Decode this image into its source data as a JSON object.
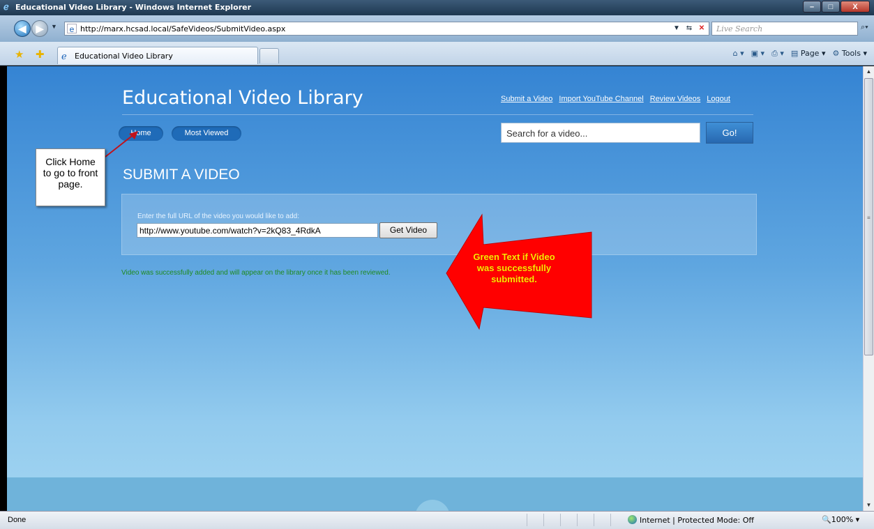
{
  "window": {
    "title": "Educational Video Library - Windows Internet Explorer",
    "min": "–",
    "max": "□",
    "close": "X"
  },
  "browser": {
    "url": "http://marx.hcsad.local/SafeVideos/SubmitVideo.aspx",
    "live_search_placeholder": "Live Search",
    "tab_label": "Educational Video Library",
    "commands": {
      "page": "Page",
      "tools": "Tools"
    }
  },
  "site": {
    "title": "Educational Video Library",
    "top_links": [
      "Submit a Video",
      "Import YouTube Channel",
      "Review Videos",
      "Logout"
    ],
    "nav": {
      "home": "Home",
      "most_viewed": "Most Viewed"
    },
    "search_placeholder": "Search for a video...",
    "go_label": "Go!"
  },
  "main": {
    "section_title": "SUBMIT A VIDEO",
    "form_label": "Enter the full URL of the video you would like to add:",
    "url_value": "http://www.youtube.com/watch?v=2kQ83_4RdkA",
    "get_button": "Get Video",
    "success_message": "Video was successfully added and will appear on the library once it has been reviewed."
  },
  "annotations": {
    "callout": "Click Home to go to front page.",
    "callout_lines": [
      "Click Home",
      "to go to front",
      "page."
    ],
    "arrow_lines": [
      "Green Text if Video",
      "was successfully",
      "submitted."
    ]
  },
  "status": {
    "left": "Done",
    "zone": "Internet | Protected Mode: Off",
    "zoom": "100%"
  },
  "colors": {
    "success_text": "#1f8a1f",
    "arrow_fill": "#ff0000",
    "arrow_text": "#ffe600"
  }
}
